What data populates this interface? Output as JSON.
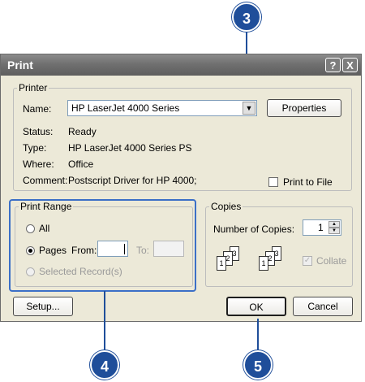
{
  "dialog": {
    "title": "Print",
    "help_button": "?",
    "close_button": "X"
  },
  "printer": {
    "group_label": "Printer",
    "name_label": "Name:",
    "name_value": "HP LaserJet 4000 Series",
    "properties_button": "Properties",
    "status_label": "Status:",
    "status_value": "Ready",
    "type_label": "Type:",
    "type_value": "HP LaserJet 4000 Series PS",
    "where_label": "Where:",
    "where_value": "Office",
    "comment_label": "Comment:",
    "comment_value": "Postscript Driver for HP 4000;",
    "print_to_file_label": "Print to File"
  },
  "print_range": {
    "group_label": "Print Range",
    "all_label": "All",
    "pages_label": "Pages",
    "from_label": "From:",
    "from_value": "",
    "to_label": "To:",
    "to_value": "",
    "selected_records_label": "Selected Record(s)"
  },
  "copies": {
    "group_label": "Copies",
    "number_label": "Number of Copies:",
    "number_value": "1",
    "collate_label": "Collate",
    "page_numbers": [
      "1",
      "2",
      "3"
    ]
  },
  "buttons": {
    "setup": "Setup...",
    "ok": "OK",
    "cancel": "Cancel"
  },
  "callouts": {
    "top": "3",
    "bottom_left": "4",
    "bottom_right": "5"
  },
  "colors": {
    "callout": "#1f4e9a",
    "highlight": "#3b6fc7",
    "dialog_bg": "#ece9d8"
  }
}
